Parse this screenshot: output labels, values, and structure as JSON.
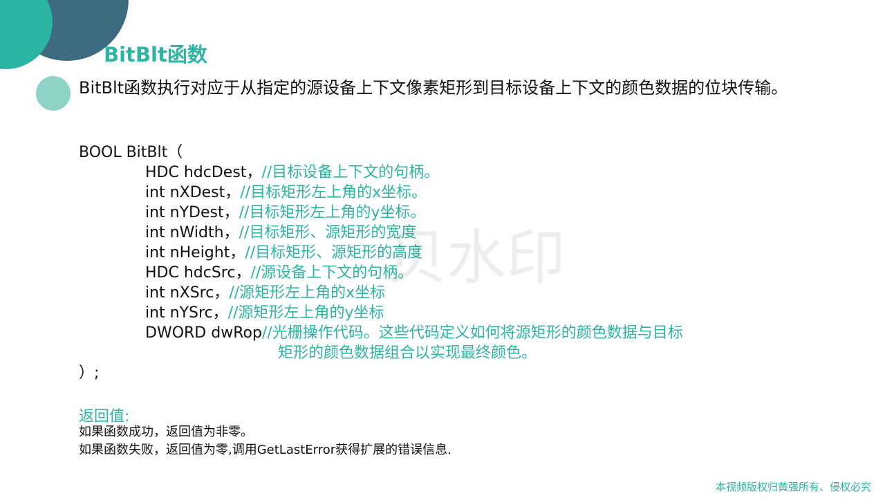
{
  "title": "BitBlt函数",
  "intro": "BitBlt函数执行对应于从指定的源设备上下文像素矩形到目标设备上下文的颜色数据的位块传输。",
  "code": {
    "open": "BOOL BitBlt（",
    "params": [
      {
        "decl": "HDC hdcDest，",
        "comment": "//目标设备上下文的句柄。"
      },
      {
        "decl": "int    nXDest，",
        "comment": "//目标矩形左上角的x坐标。"
      },
      {
        "decl": "int    nYDest，",
        "comment": "//目标矩形左上角的y坐标。"
      },
      {
        "decl": "int    nWidth，",
        "comment": "//目标矩形、源矩形的宽度"
      },
      {
        "decl": "int    nHeight，",
        "comment": "//目标矩形、源矩形的高度"
      },
      {
        "decl": "HDC hdcSrc，",
        "comment": "//源设备上下文的句柄。"
      },
      {
        "decl": "int    nXSrc，",
        "comment": "//源矩形左上角的x坐标"
      },
      {
        "decl": "int    nYSrc，",
        "comment": "//源矩形左上角的y坐标"
      },
      {
        "decl": "DWORD dwRop",
        "comment": "//光栅操作代码。这些代码定义如何将源矩形的颜色数据与目标"
      }
    ],
    "continuation": "矩形的颜色数据组合以实现最终颜色。",
    "close": "）;"
  },
  "return_section": {
    "title": "返回值:",
    "lines": [
      "如果函数成功，返回值为非零。",
      "如果函数失败，返回值为零,调用GetLastError获得扩展的错误信息."
    ]
  },
  "watermark": "贝水印",
  "footer": "本视频版权归黄强所有、侵权必究",
  "colors": {
    "accent": "#2bb5a2",
    "dark_circle": "#3d6b80",
    "light_circle": "#8fd3c7"
  }
}
